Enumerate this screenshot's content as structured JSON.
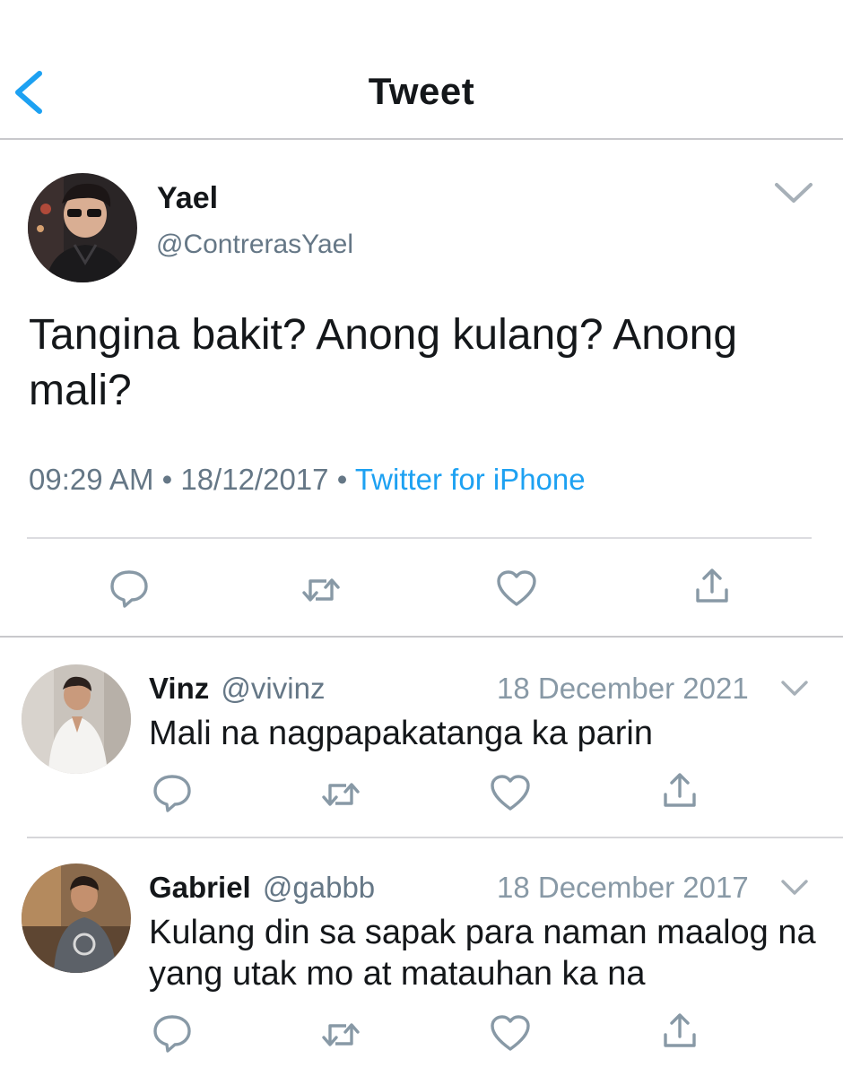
{
  "header": {
    "title": "Tweet"
  },
  "main_tweet": {
    "name": "Yael",
    "handle": "@ContrerasYael",
    "text": "Tangina bakit? Anong kulang? Anong mali?",
    "time": "09:29 AM",
    "date": "18/12/2017",
    "source": "Twitter for iPhone",
    "separator": "•"
  },
  "replies": [
    {
      "name": "Vinz",
      "handle": "@vivinz",
      "date": "18 December 2021",
      "text": "Mali na nagpapakatanga ka parin"
    },
    {
      "name": "Gabriel",
      "handle": "@gabbb",
      "date": "18 December 2017",
      "text": "Kulang din sa sapak para naman maalog na yang utak mo at matauhan ka na"
    }
  ],
  "icons": [
    "back-chevron-icon",
    "chevron-down-icon",
    "reply-icon",
    "retweet-icon",
    "like-icon",
    "share-icon"
  ],
  "colors": {
    "accent": "#1da1f2",
    "secondary_text": "#657786",
    "icon_gray": "#8899a6",
    "divider": "#c8c8cc"
  }
}
